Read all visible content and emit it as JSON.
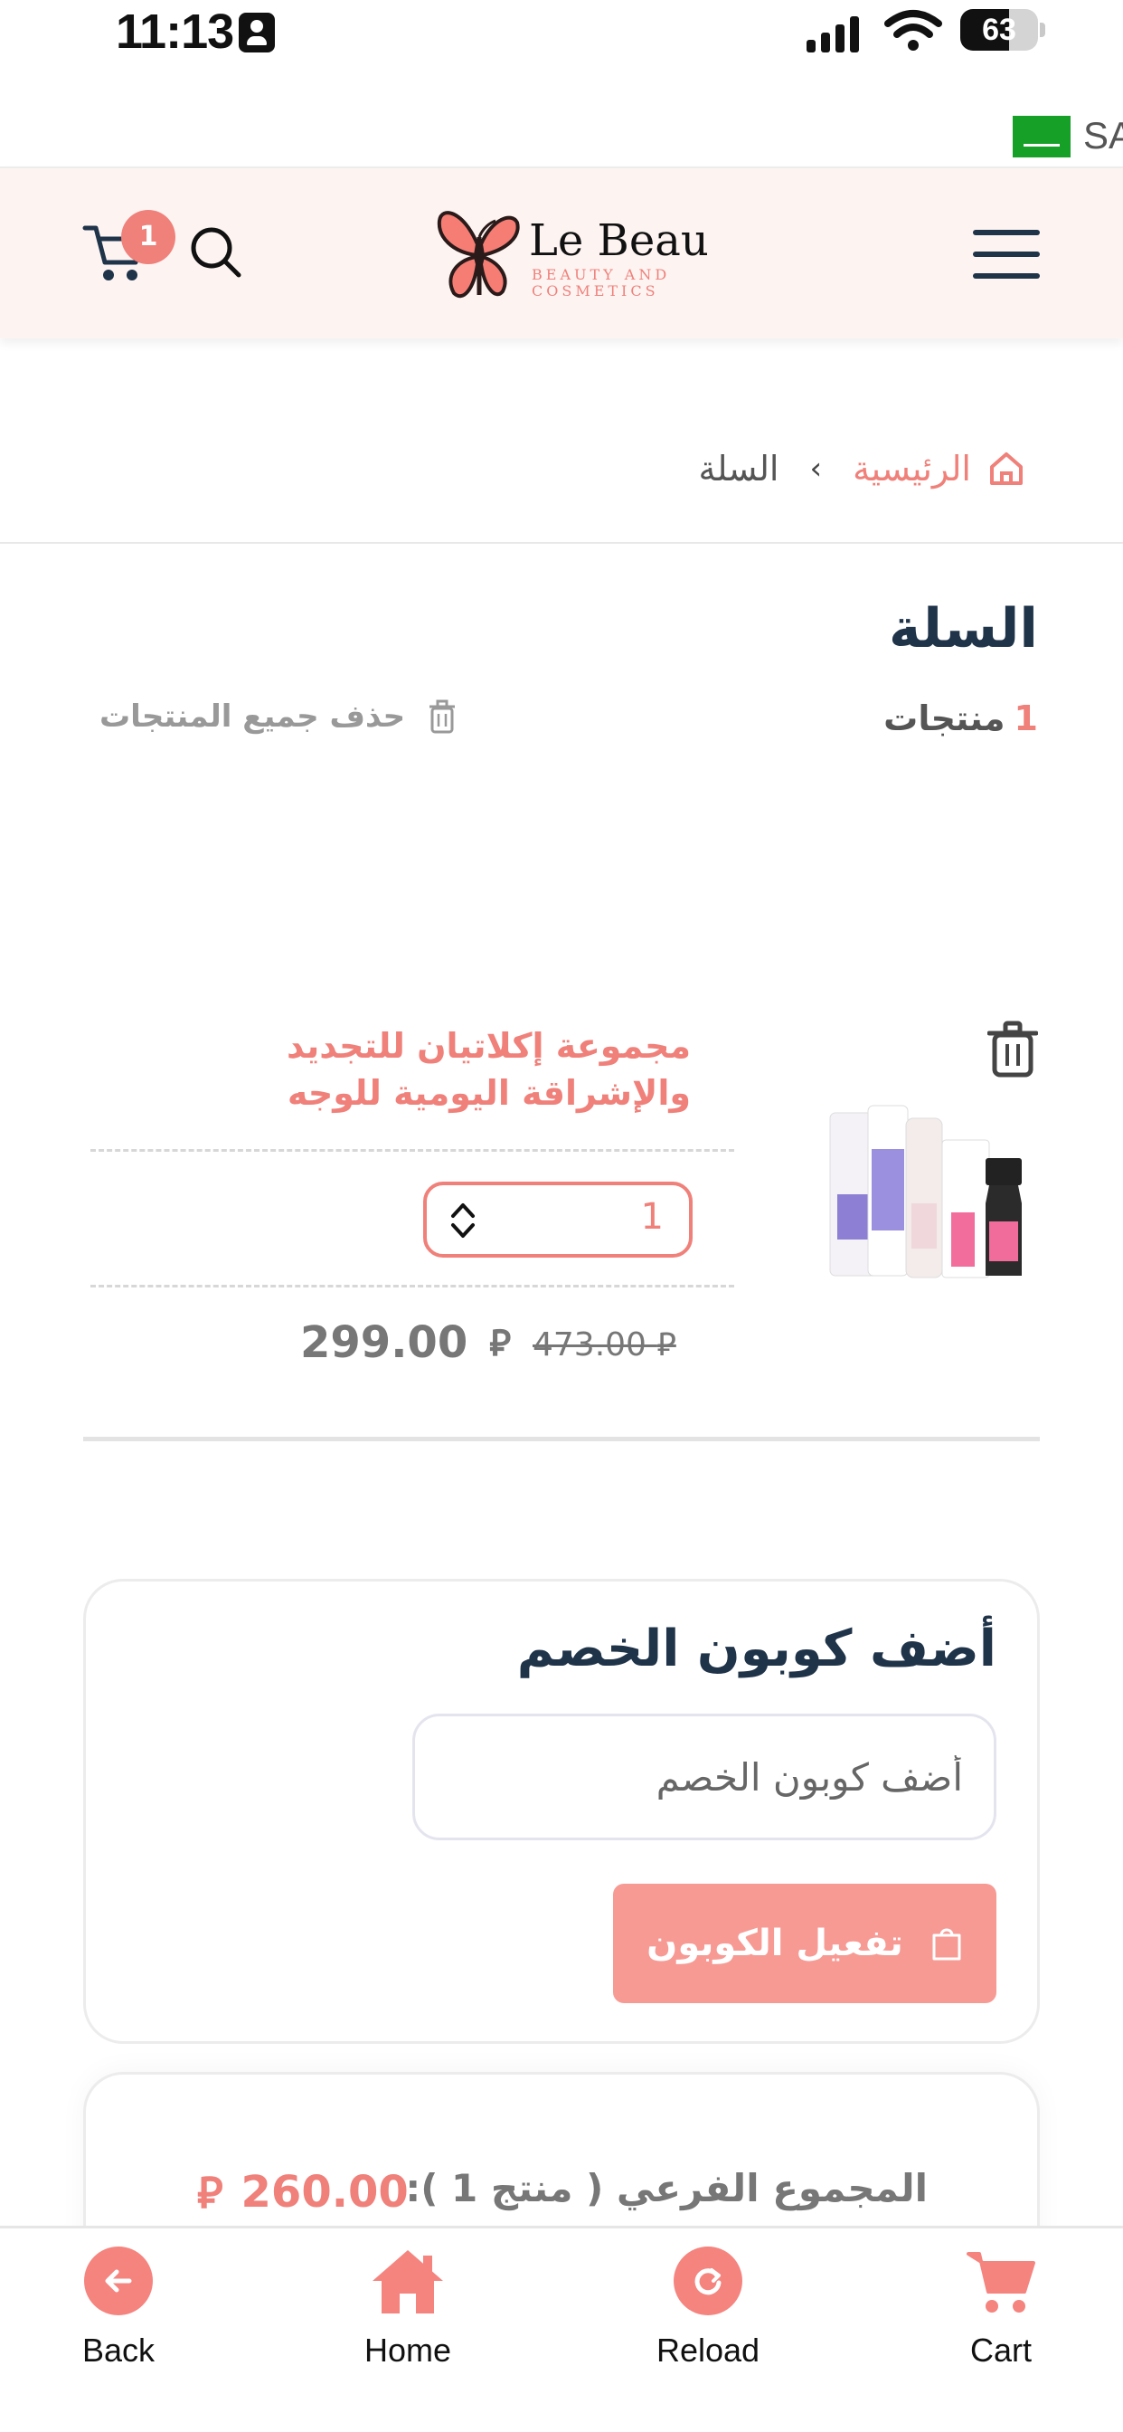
{
  "status_bar": {
    "time": "11:13",
    "battery": "63",
    "battery_level": 0.63
  },
  "language": {
    "code": "SA",
    "flag_icon": "saudi-flag-icon"
  },
  "header": {
    "logo_title": "Le Beau",
    "logo_subtitle_line1": "BEAUTY AND",
    "logo_subtitle_line2": "COSMETICS",
    "cart_count": "1",
    "icons": [
      "hamburger-menu-icon",
      "butterfly-logo-icon",
      "search-icon",
      "cart-icon"
    ]
  },
  "breadcrumb": {
    "home": "الرئيسية",
    "separator": "›",
    "current": "السلة"
  },
  "cart": {
    "title": "السلة",
    "count": "1",
    "count_label": "منتجات",
    "clear_all": "حذف جميع المنتجات"
  },
  "item": {
    "name": "مجموعة إكلاتيان للتجديد والإشراقة اليومية للوجه",
    "quantity": "1",
    "price": "299.00",
    "old_price": "473.00",
    "currency_symbol": "⃁"
  },
  "coupon": {
    "title": "أضف كوبون الخصم",
    "placeholder": "أضف كوبون الخصم",
    "button": "تفعيل الكوبون"
  },
  "summary": {
    "subtotal_label": "المجموع الفرعي ( منتج 1 ):",
    "subtotal_value": "260.00"
  },
  "bottom_nav": {
    "back": "Back",
    "home": "Home",
    "reload": "Reload",
    "cart": "Cart"
  },
  "colors": {
    "accent": "#f0807a",
    "navy": "#1f3349",
    "button": "#f79a94"
  }
}
